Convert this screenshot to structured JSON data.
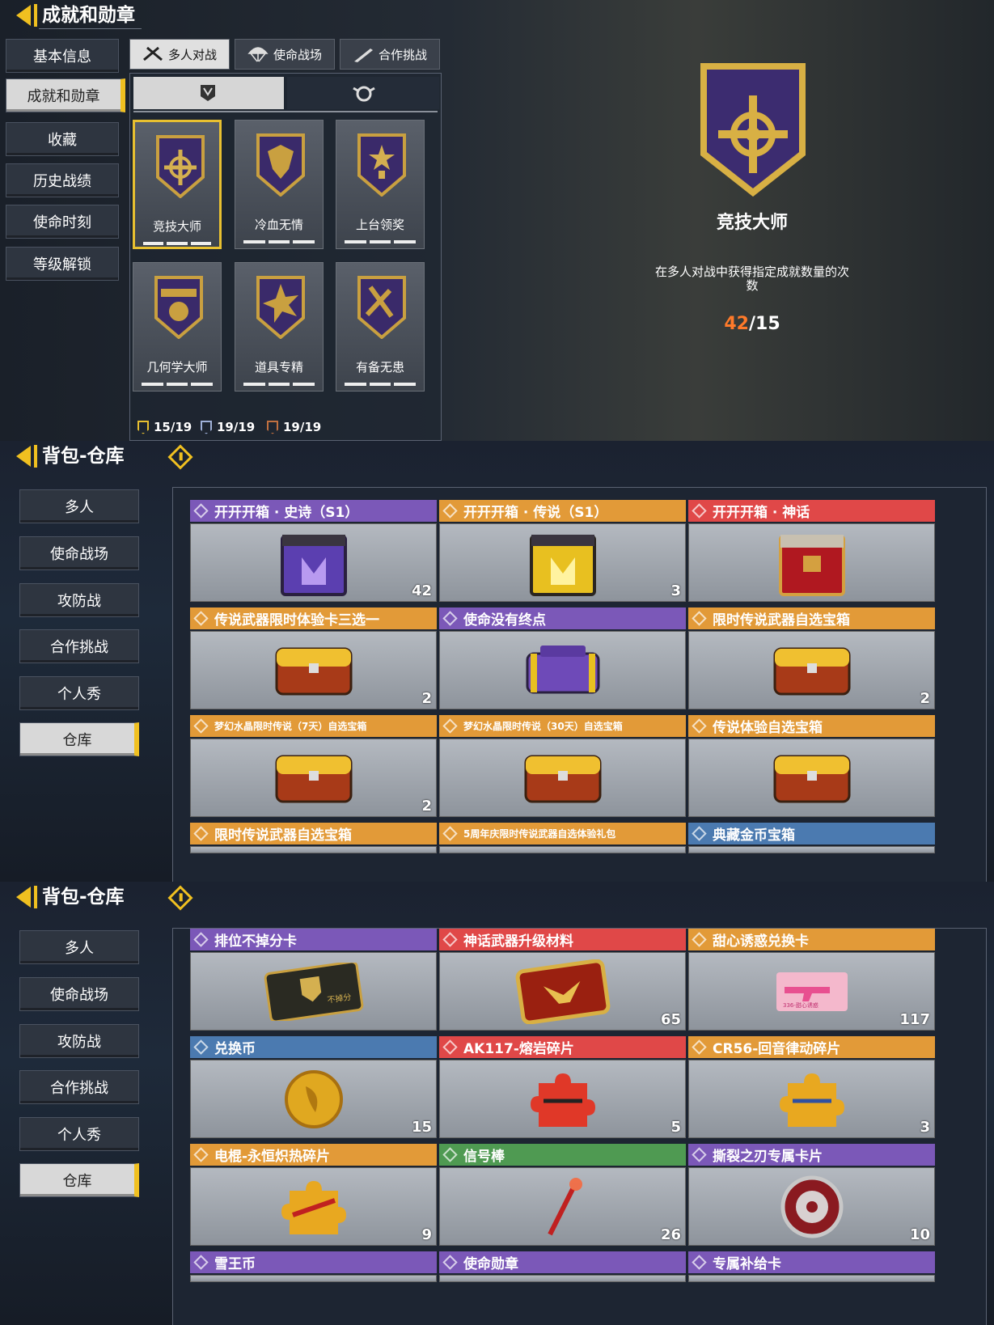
{
  "s1": {
    "title": "成就和勋章",
    "sidebar": [
      "基本信息",
      "成就和勋章",
      "收藏",
      "历史战绩",
      "使命时刻",
      "等级解锁"
    ],
    "tabs": [
      "多人对战",
      "使命战场",
      "合作挑战"
    ],
    "badges": [
      "竞技大师",
      "冷血无情",
      "上台领奖",
      "几何学大师",
      "道具专精",
      "有备无患"
    ],
    "summary": [
      "15/19",
      "19/19",
      "19/19"
    ],
    "detail": {
      "name": "竞技大师",
      "desc": "在多人对战中获得指定成就数量的次数",
      "cur": "42",
      "total": "/15"
    }
  },
  "s2": {
    "title": "背包-仓库",
    "sidebar": [
      "多人",
      "使命战场",
      "攻防战",
      "合作挑战",
      "个人秀",
      "仓库"
    ],
    "items": [
      {
        "name": "开开开箱 · 史诗（S1）",
        "count": "42"
      },
      {
        "name": "开开开箱 · 传说（S1）",
        "count": "3"
      },
      {
        "name": "开开开箱 · 神话",
        "count": ""
      },
      {
        "name": "传说武器限时体验卡三选一",
        "count": "2"
      },
      {
        "name": "使命没有终点",
        "count": ""
      },
      {
        "name": "限时传说武器自选宝箱",
        "count": "2"
      },
      {
        "name": "梦幻水晶限时传说（7天）自选宝箱",
        "count": "2"
      },
      {
        "name": "梦幻水晶限时传说（30天）自选宝箱",
        "count": ""
      },
      {
        "name": "传说体验自选宝箱",
        "count": ""
      },
      {
        "name": "限时传说武器自选宝箱",
        "count": ""
      },
      {
        "name": "5周年庆限时传说武器自选体验礼包",
        "count": ""
      },
      {
        "name": "典藏金币宝箱",
        "count": ""
      }
    ]
  },
  "s3": {
    "title": "背包-仓库",
    "sidebar": [
      "多人",
      "使命战场",
      "攻防战",
      "合作挑战",
      "个人秀",
      "仓库"
    ],
    "items": [
      {
        "name": "排位不掉分卡",
        "count": ""
      },
      {
        "name": "神话武器升级材料",
        "count": "65"
      },
      {
        "name": "甜心诱惑兑换卡",
        "count": "117"
      },
      {
        "name": "兑换币",
        "count": "15"
      },
      {
        "name": "AK117-熔岩碎片",
        "count": "5"
      },
      {
        "name": "CR56-回音律动碎片",
        "count": "3"
      },
      {
        "name": "电棍-永恒炽热碎片",
        "count": "9"
      },
      {
        "name": "信号棒",
        "count": "26"
      },
      {
        "name": "撕裂之刃专属卡片",
        "count": "10"
      },
      {
        "name": "雪王币",
        "count": ""
      },
      {
        "name": "使命勋章",
        "count": ""
      },
      {
        "name": "专属补给卡",
        "count": ""
      }
    ],
    "card_text": "不掉分",
    "pink_card_text": "336-甜心诱惑"
  },
  "colors": {
    "accent": "#f0c020",
    "epic": "#7b58b8",
    "legend": "#e29a38",
    "myth": "#e04848",
    "rare": "#4b7ab0",
    "uncommon": "#4f9a52",
    "progress": "#ff7a2a"
  }
}
